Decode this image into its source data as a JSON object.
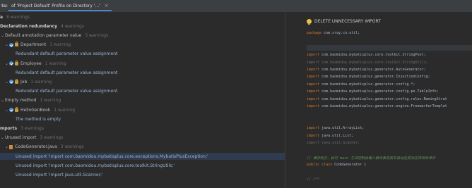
{
  "tabbar": {
    "prefix": "ts:",
    "tab_label": "of 'Project Default' Profile on Directory '...'",
    "close_glyph": "×"
  },
  "tree": [
    {
      "indent": 0,
      "arrow": "",
      "icons": [],
      "label": "a",
      "count": "8 warnings",
      "style": "bold"
    },
    {
      "indent": 0,
      "arrow": "",
      "icons": [],
      "label": "Declaration redundancy",
      "count": "4 warnings",
      "style": "bold"
    },
    {
      "indent": 0,
      "arrow": "v",
      "icons": [],
      "label": "Default annotation parameter value",
      "count": "3 warnings",
      "style": "norm"
    },
    {
      "indent": 1,
      "arrow": "v",
      "icons": [
        "check",
        "lock"
      ],
      "label": "Department",
      "count": "1 warning",
      "style": "norm"
    },
    {
      "indent": 2,
      "arrow": "",
      "icons": [],
      "label": "Redundant default parameter value assignment",
      "count": "",
      "style": "item"
    },
    {
      "indent": 1,
      "arrow": "v",
      "icons": [
        "check",
        "lock"
      ],
      "label": "Employee",
      "count": "1 warning",
      "style": "norm"
    },
    {
      "indent": 2,
      "arrow": "",
      "icons": [],
      "label": "Redundant default parameter value assignment",
      "count": "",
      "style": "item"
    },
    {
      "indent": 1,
      "arrow": "v",
      "icons": [
        "check",
        "lock"
      ],
      "label": "Job",
      "count": "1 warning",
      "style": "norm"
    },
    {
      "indent": 2,
      "arrow": "",
      "icons": [],
      "label": "Redundant default parameter value assignment",
      "count": "",
      "style": "item"
    },
    {
      "indent": 0,
      "arrow": "v",
      "icons": [],
      "label": "Empty method",
      "count": "1 warning",
      "style": "norm"
    },
    {
      "indent": 1,
      "arrow": "v",
      "icons": [
        "check",
        "lock"
      ],
      "label": "HelloGenBook",
      "count": "1 warning",
      "style": "norm"
    },
    {
      "indent": 2,
      "arrow": "",
      "icons": [],
      "label": "The method is empty",
      "count": "",
      "style": "item"
    },
    {
      "indent": 0,
      "arrow": "",
      "icons": [],
      "label": "mports",
      "count": "3 warnings",
      "style": "bold"
    },
    {
      "indent": 0,
      "arrow": "v",
      "icons": [],
      "label": "Unused import",
      "count": "3 warnings",
      "style": "norm"
    },
    {
      "indent": 1,
      "arrow": "v",
      "icons": [
        "file"
      ],
      "label": "CodeGenerator.java",
      "count": "3 warnings",
      "style": "norm"
    },
    {
      "indent": 2,
      "arrow": "",
      "icons": [],
      "label": "Unused import 'import com.baomidou.mybatisplus.core.exceptions.MybatisPlusException;'",
      "count": "",
      "style": "item",
      "selected": true
    },
    {
      "indent": 2,
      "arrow": "",
      "icons": [],
      "label": "Unused import 'import com.baomidou.mybatisplus.core.toolkit.StringUtils;'",
      "count": "",
      "style": "item"
    },
    {
      "indent": 2,
      "arrow": "",
      "icons": [],
      "label": "Unused import 'import java.util.Scanner;'",
      "count": "",
      "style": "item"
    }
  ],
  "preview": {
    "fix_label": "DELETE UNNECESSARY IMPORT",
    "lines": [
      {
        "segments": [
          {
            "t": "package ",
            "c": "kw"
          },
          {
            "t": "com.xray.cn.util;",
            "c": "pk"
          }
        ]
      },
      {
        "segments": []
      },
      {
        "segments": [],
        "highlight": true
      },
      {
        "segments": [
          {
            "t": "import ",
            "c": "kw"
          },
          {
            "t": "com.baomidou.mybatisplus.core.toolkit.StringPool;",
            "c": "pk"
          }
        ]
      },
      {
        "segments": [
          {
            "t": "import com.baomidou.mybatisplus.core.toolkit.StringUtils;",
            "c": "unused"
          }
        ]
      },
      {
        "segments": [
          {
            "t": "import ",
            "c": "kw"
          },
          {
            "t": "com.baomidou.mybatisplus.generator.AutoGenerator;",
            "c": "pk"
          }
        ]
      },
      {
        "segments": [
          {
            "t": "import ",
            "c": "kw"
          },
          {
            "t": "com.baomidou.mybatisplus.generator.InjectionConfig;",
            "c": "pk"
          }
        ]
      },
      {
        "segments": [
          {
            "t": "import ",
            "c": "kw"
          },
          {
            "t": "com.baomidou.mybatisplus.generator.config.*;",
            "c": "pk"
          }
        ]
      },
      {
        "segments": [
          {
            "t": "import ",
            "c": "kw"
          },
          {
            "t": "com.baomidou.mybatisplus.generator.config.po.TableInfo;",
            "c": "pk"
          }
        ]
      },
      {
        "segments": [
          {
            "t": "import ",
            "c": "kw"
          },
          {
            "t": "com.baomidou.mybatisplus.generator.config.rules.NamingStrat",
            "c": "pk"
          }
        ]
      },
      {
        "segments": [
          {
            "t": "import ",
            "c": "kw"
          },
          {
            "t": "com.baomidou.mybatisplus.generator.engine.FreemarkerTemplat",
            "c": "pk"
          }
        ]
      },
      {
        "segments": []
      },
      {
        "segments": []
      },
      {
        "segments": [
          {
            "t": "import ",
            "c": "kw"
          },
          {
            "t": "java.util.ArrayList;",
            "c": "pk"
          }
        ]
      },
      {
        "segments": [
          {
            "t": "import ",
            "c": "kw"
          },
          {
            "t": "java.util.List;",
            "c": "pk"
          }
        ]
      },
      {
        "segments": [
          {
            "t": "import java.util.Scanner;",
            "c": "unused"
          }
        ]
      },
      {
        "segments": []
      },
      {
        "segments": [
          {
            "t": "// 演示例子，执行 main 方法控制台输入模块表名回车自动生成对应项目目录中",
            "c": "cmt"
          }
        ]
      },
      {
        "segments": [
          {
            "t": "public class ",
            "c": "kw"
          },
          {
            "t": "CodeGenerator {",
            "c": "pk"
          }
        ]
      },
      {
        "segments": []
      },
      {
        "segments": [
          {
            "t": "    //    /**",
            "c": "unused"
          }
        ]
      }
    ]
  }
}
